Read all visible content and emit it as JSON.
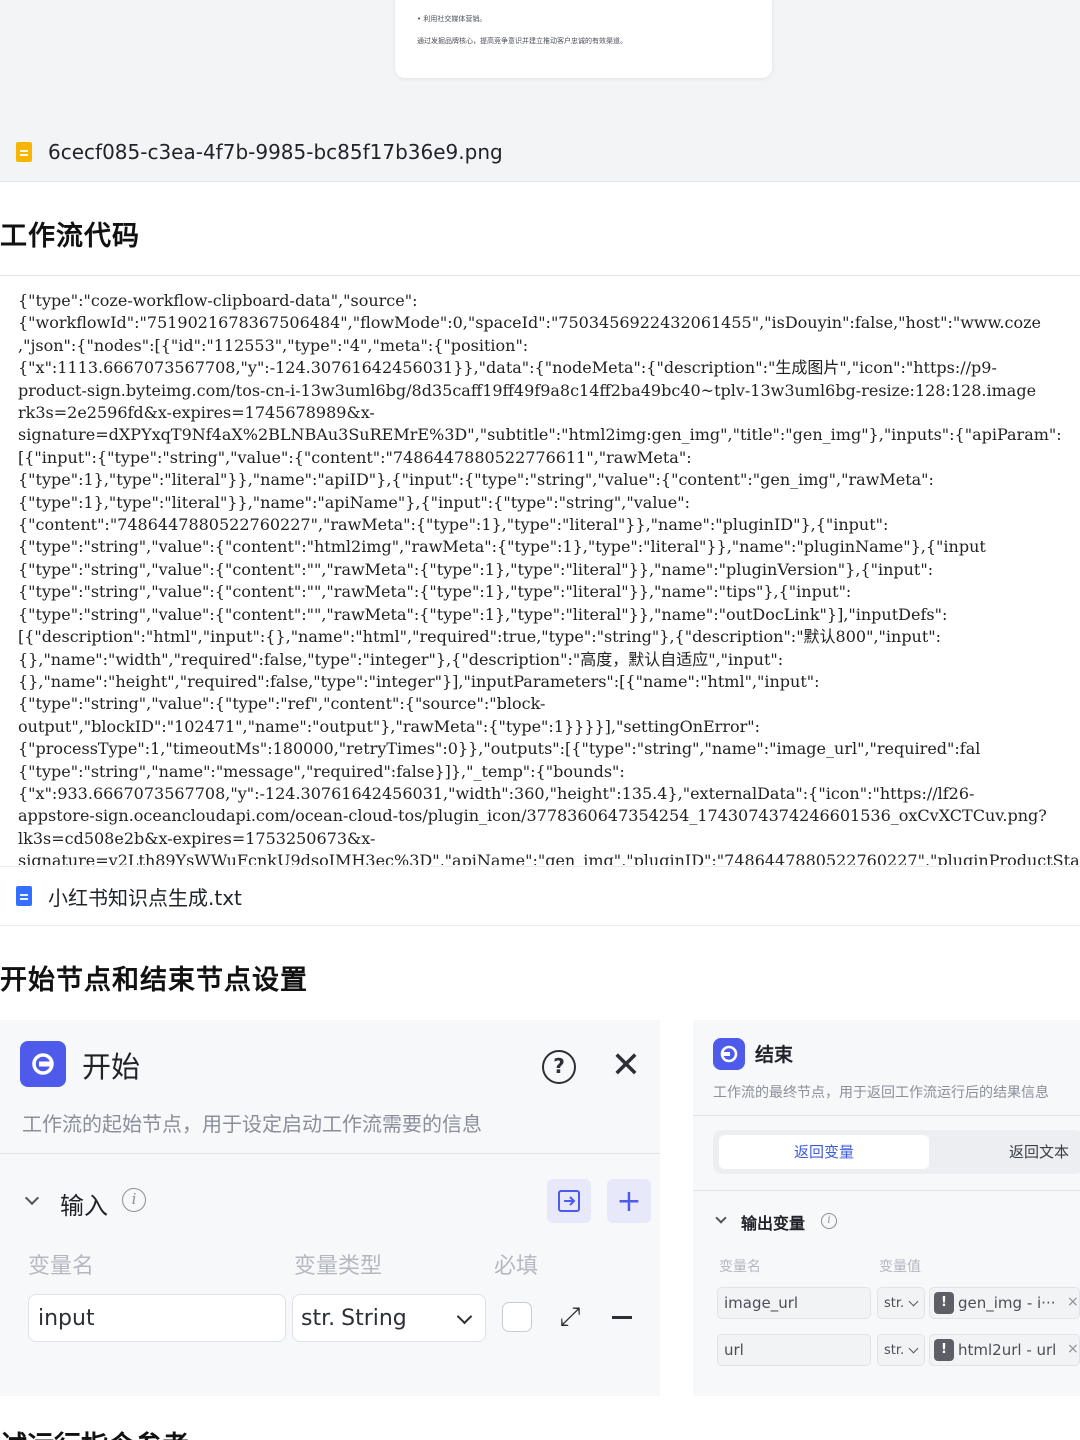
{
  "preview": {
    "thumb_line_1": "• 利用社交媒体营销。",
    "thumb_line_2": "通过发掘品牌核心，提高竞争意识并建立推动客户忠诚的有效渠道。"
  },
  "file_image": {
    "name": "6cecf085-c3ea-4f7b-9985-bc85f17b36e9.png",
    "icon": "image-file-icon",
    "color": "#f7b500"
  },
  "workflow_code": {
    "heading": "工作流代码",
    "lines": [
      "{\"type\":\"coze-workflow-clipboard-data\",\"source\":",
      "{\"workflowId\":\"7519021678367506484\",\"flowMode\":0,\"spaceId\":\"7503456922432061455\",\"isDouyin\":false,\"host\":\"www.coze",
      ",\"json\":{\"nodes\":[{\"id\":\"112553\",\"type\":\"4\",\"meta\":{\"position\":",
      "{\"x\":1113.6667073567708,\"y\":-124.30761642456031}},\"data\":{\"nodeMeta\":{\"description\":\"生成图片\",\"icon\":\"https://p9-",
      "product-sign.byteimg.com/tos-cn-i-13w3uml6bg/8d35caff19ff49f9a8c14ff2ba49bc40~tplv-13w3uml6bg-resize:128:128.image",
      "rk3s=2e2596fd&x-expires=1745678989&x-",
      "signature=dXPYxqT9Nf4aX%2BLNBAu3SuREMrE%3D\",\"subtitle\":\"html2img:gen_img\",\"title\":\"gen_img\"},\"inputs\":{\"apiParam\":",
      "[{\"input\":{\"type\":\"string\",\"value\":{\"content\":\"7486447880522776611\",\"rawMeta\":",
      "{\"type\":1},\"type\":\"literal\"}},\"name\":\"apiID\"},{\"input\":{\"type\":\"string\",\"value\":{\"content\":\"gen_img\",\"rawMeta\":",
      "{\"type\":1},\"type\":\"literal\"}},\"name\":\"apiName\"},{\"input\":{\"type\":\"string\",\"value\":",
      "{\"content\":\"7486447880522760227\",\"rawMeta\":{\"type\":1},\"type\":\"literal\"}},\"name\":\"pluginID\"},{\"input\":",
      "{\"type\":\"string\",\"value\":{\"content\":\"html2img\",\"rawMeta\":{\"type\":1},\"type\":\"literal\"}},\"name\":\"pluginName\"},{\"input",
      "{\"type\":\"string\",\"value\":{\"content\":\"\",\"rawMeta\":{\"type\":1},\"type\":\"literal\"}},\"name\":\"pluginVersion\"},{\"input\":",
      "{\"type\":\"string\",\"value\":{\"content\":\"\",\"rawMeta\":{\"type\":1},\"type\":\"literal\"}},\"name\":\"tips\"},{\"input\":",
      "{\"type\":\"string\",\"value\":{\"content\":\"\",\"rawMeta\":{\"type\":1},\"type\":\"literal\"}},\"name\":\"outDocLink\"}],\"inputDefs\":",
      "[{\"description\":\"html\",\"input\":{},\"name\":\"html\",\"required\":true,\"type\":\"string\"},{\"description\":\"默认800\",\"input\":",
      "{},\"name\":\"width\",\"required\":false,\"type\":\"integer\"},{\"description\":\"高度，默认自适应\",\"input\":",
      "{},\"name\":\"height\",\"required\":false,\"type\":\"integer\"}],\"inputParameters\":[{\"name\":\"html\",\"input\":",
      "{\"type\":\"string\",\"value\":{\"type\":\"ref\",\"content\":{\"source\":\"block-",
      "output\",\"blockID\":\"102471\",\"name\":\"output\"},\"rawMeta\":{\"type\":1}}}}],\"settingOnError\":",
      "{\"processType\":1,\"timeoutMs\":180000,\"retryTimes\":0}},\"outputs\":[{\"type\":\"string\",\"name\":\"image_url\",\"required\":fal",
      "{\"type\":\"string\",\"name\":\"message\",\"required\":false}]},\"_temp\":{\"bounds\":",
      "{\"x\":933.6667073567708,\"y\":-124.30761642456031,\"width\":360,\"height\":135.4},\"externalData\":{\"icon\":\"https://lf26-",
      "appstore-sign.oceancloudapi.com/ocean-cloud-tos/plugin_icon/3778360647354254_1743074374246601536_oxCvXCTCuv.png?",
      "lk3s=cd508e2b&x-expires=1753250673&x-",
      "signature=v2Lth89YsWWuFcnkU9dsoIMH3ec%3D\",\"apiName\":\"gen_img\",\"pluginID\":\"7486447880522760227\",\"pluginProductStatu"
    ]
  },
  "file_txt": {
    "name": "小红书知识点生成.txt",
    "icon": "text-file-icon",
    "color": "#3370ff"
  },
  "nodes_section": {
    "heading": "开始节点和结束节点设置"
  },
  "start_node": {
    "title": "开始",
    "description": "工作流的起始节点，用于设定启动工作流需要的信息",
    "icon": "start-node-icon",
    "accent": "#4e5bea",
    "input_section": "输入",
    "columns": {
      "name": "变量名",
      "type": "变量类型",
      "required": "必填"
    },
    "row": {
      "name": "input",
      "type_prefix": "str.",
      "type": "String"
    }
  },
  "end_node": {
    "title": "结束",
    "description": "工作流的最终节点，用于返回工作流运行后的结果信息",
    "icon": "end-node-icon",
    "tabs": {
      "active": "返回变量",
      "other": "返回文本"
    },
    "output_section": "输出变量",
    "columns": {
      "name": "变量名",
      "value": "变量值"
    },
    "rows": [
      {
        "name": "image_url",
        "type": "str.",
        "ref": "gen_img - i···"
      },
      {
        "name": "url",
        "type": "str.",
        "ref": "html2url - url"
      }
    ]
  },
  "next_heading": "试运行指令参考"
}
